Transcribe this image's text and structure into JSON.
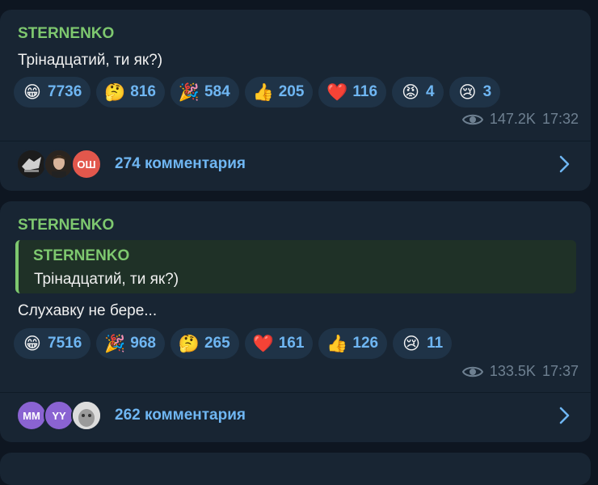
{
  "posts": [
    {
      "author": "STERNENKO",
      "text": "Трінадцатий, ти як?)",
      "reactions": [
        {
          "emoji": "😁",
          "name": "grin",
          "count": "7736"
        },
        {
          "emoji": "🤔",
          "name": "thinking",
          "count": "816"
        },
        {
          "emoji": "🎉",
          "name": "party",
          "count": "584"
        },
        {
          "emoji": "👍",
          "name": "thumbs-up",
          "count": "205"
        },
        {
          "emoji": "❤️",
          "name": "heart",
          "count": "116"
        },
        {
          "emoji": "😡",
          "name": "angry",
          "count": "4"
        },
        {
          "emoji": "😢",
          "name": "crying",
          "count": "3"
        }
      ],
      "views": "147.2K",
      "time": "17:32",
      "comments_label": "274 комментария",
      "avatars": [
        {
          "initials": "",
          "color": "#2a2a2a"
        },
        {
          "initials": "",
          "color": "#5a4a3a"
        },
        {
          "initials": "ОШ",
          "color": "#e2574c"
        }
      ]
    },
    {
      "author": "STERNENKO",
      "quote": {
        "author": "STERNENKO",
        "text": "Трінадцатий, ти як?)"
      },
      "text": "Слухавку не бере...",
      "reactions": [
        {
          "emoji": "😁",
          "name": "grin",
          "count": "7516"
        },
        {
          "emoji": "🎉",
          "name": "party",
          "count": "968"
        },
        {
          "emoji": "🤔",
          "name": "thinking",
          "count": "265"
        },
        {
          "emoji": "❤️",
          "name": "heart",
          "count": "161"
        },
        {
          "emoji": "👍",
          "name": "thumbs-up",
          "count": "126"
        },
        {
          "emoji": "😢",
          "name": "crying",
          "count": "11"
        }
      ],
      "views": "133.5K",
      "time": "17:37",
      "comments_label": "262 комментария",
      "avatars": [
        {
          "initials": "ММ",
          "color": "#8a63d2"
        },
        {
          "initials": "YY",
          "color": "#8a63d2"
        },
        {
          "initials": "",
          "color": "#c9c9c9"
        }
      ]
    }
  ]
}
